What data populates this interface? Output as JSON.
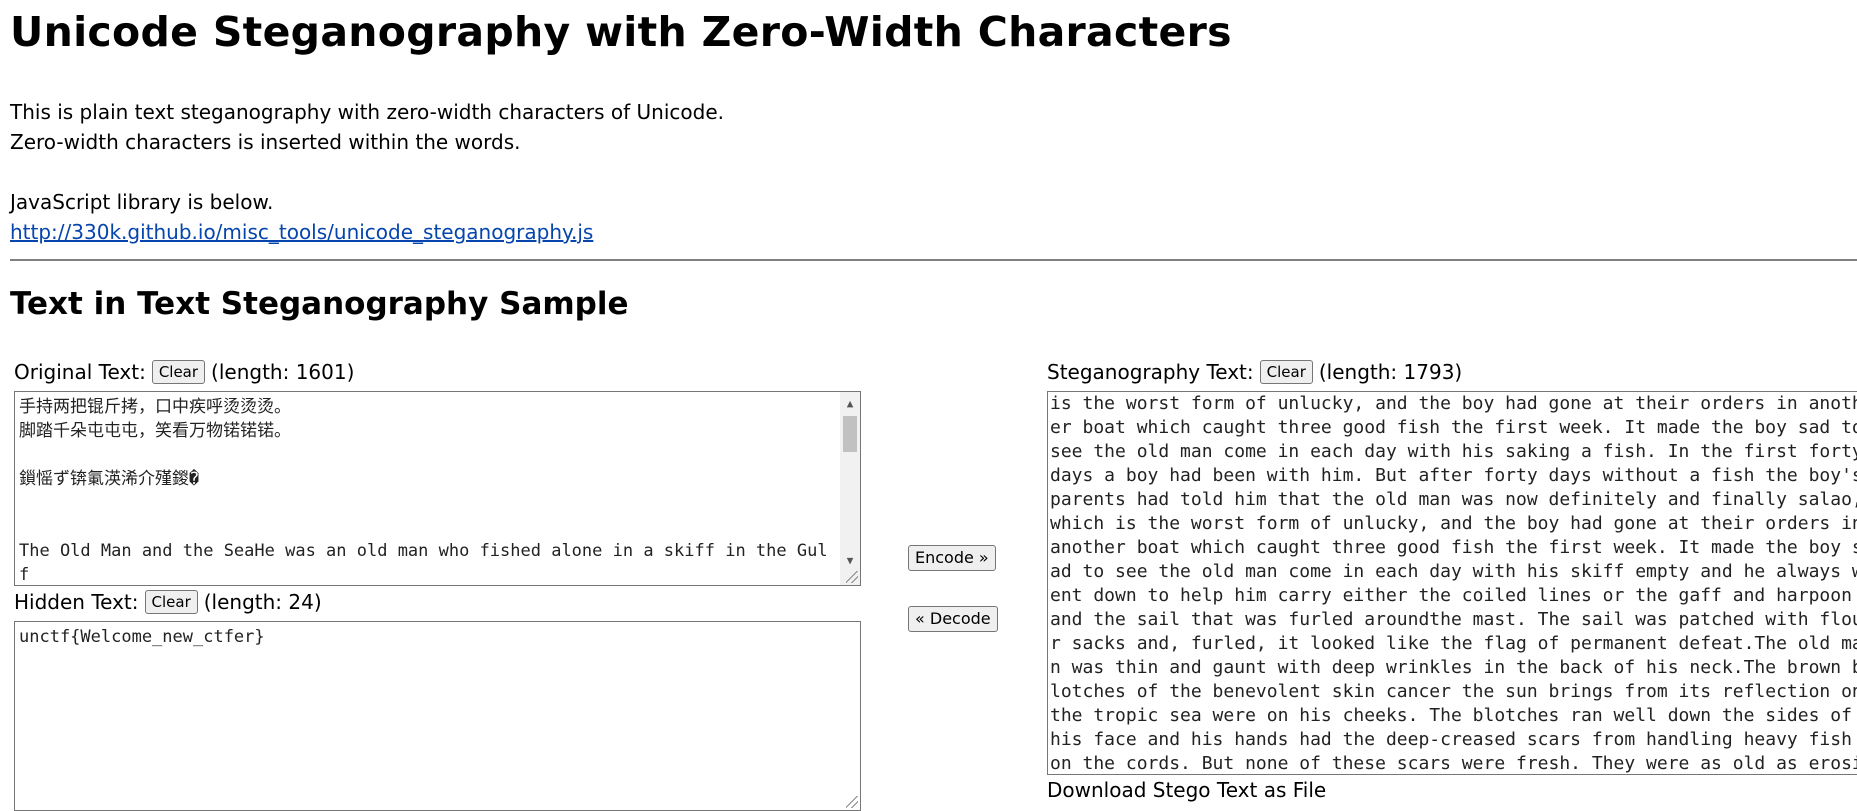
{
  "page": {
    "title": "Unicode Steganography with Zero-Width Characters",
    "intro_line1": "This is plain text steganography with zero-width characters of Unicode.",
    "intro_line2": "Zero-width characters is inserted within the words.",
    "library_label": "JavaScript library is below.",
    "library_link": "http://330k.github.io/misc_tools/unicode_steganography.js",
    "section_title": "Text in Text Steganography Sample"
  },
  "original": {
    "label": "Original Text:",
    "clear_label": "Clear",
    "length_text": "(length: 1601)",
    "content": "手持两把锟斤拷，口中疾呼烫烫烫。\n脚踏千朵屯屯屯，笑看万物锘锘锘。\n\n鎻愮ず锛氭渶浠介殣鍐�\n\n\nThe Old Man and the SeaHe was an old man who fished alone in a skiff in the Gulf"
  },
  "hidden": {
    "label": "Hidden Text:",
    "clear_label": "Clear",
    "length_text": "(length: 24)",
    "content": "unctf{Welcome_new_ctfer}"
  },
  "actions": {
    "encode_label": "Encode »",
    "decode_label": "« Decode"
  },
  "stego": {
    "label": "Steganography Text:",
    "clear_label": "Clear",
    "length_text": "(length: 1793)",
    "content": "is the worst form of unlucky, and the boy had gone at their orders in another boat which caught three good fish the first week. It made the boy sad to see the old man come in each day with his saking a fish. In the first forty days a boy had been with him. But after forty days without a fish the boy's parents had told him that the old man was now definitely and finally salao,which is the worst form of unlucky, and the boy had gone at their orders in another boat which caught three good fish the first week. It made the boy sad to see the old man come in each day with his skiff empty and he always went down to help him carry either the coiled lines or the gaff and harpoon and the sail that was furled aroundthe mast. The sail was patched with flour sacks and, furled, it looked like the flag of permanent defeat.The old man was thin and gaunt with deep wrinkles in the back of his neck.The brown blotches of the benevolent skin cancer the sun brings from its reflection on the tropic sea were on his cheeks. The blotches ran well down the sides of his face and his hands had the deep-creased scars from handling heavy fish on the cords. But none of these scars were fresh. They were as old as erosions in fishless desert.",
    "download_label": "Download Stego Text as File"
  }
}
